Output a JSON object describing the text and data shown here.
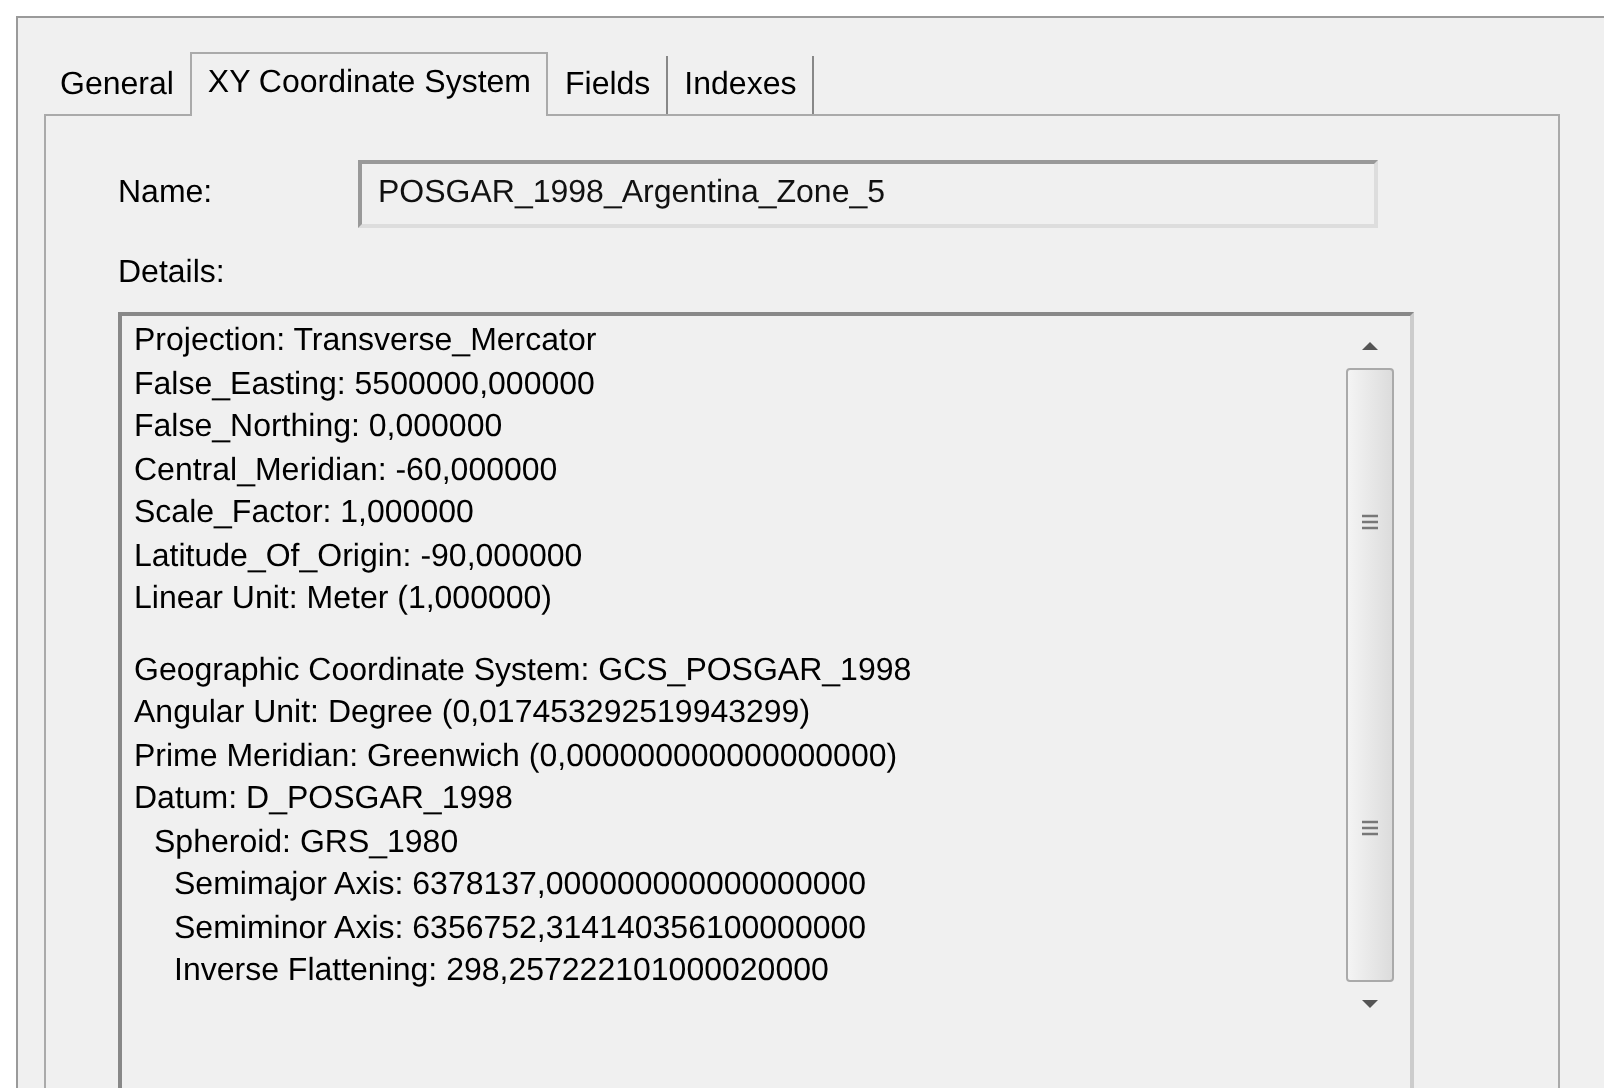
{
  "tabs": [
    {
      "label": "General",
      "selected": false
    },
    {
      "label": "XY Coordinate System",
      "selected": true
    },
    {
      "label": "Fields",
      "selected": false
    },
    {
      "label": "Indexes",
      "selected": false
    }
  ],
  "name_field": {
    "label": "Name:",
    "value": "POSGAR_1998_Argentina_Zone_5"
  },
  "details": {
    "label": "Details:",
    "sections": [
      {
        "lines": [
          {
            "text": "Projection: Transverse_Mercator"
          },
          {
            "text": "False_Easting: 5500000,000000"
          },
          {
            "text": "False_Northing: 0,000000"
          },
          {
            "text": "Central_Meridian: -60,000000"
          },
          {
            "text": "Scale_Factor: 1,000000"
          },
          {
            "text": "Latitude_Of_Origin: -90,000000"
          },
          {
            "text": "Linear Unit: Meter (1,000000)"
          }
        ]
      },
      {
        "lines": [
          {
            "text": "Geographic Coordinate System: GCS_POSGAR_1998"
          },
          {
            "text": "Angular Unit: Degree (0,017453292519943299)"
          },
          {
            "text": "Prime Meridian: Greenwich (0,000000000000000000)"
          },
          {
            "text": "Datum: D_POSGAR_1998",
            "children": [
              {
                "text": "Spheroid: GRS_1980",
                "children": [
                  {
                    "text": "Semimajor Axis: 6378137,000000000000000000"
                  },
                  {
                    "text": "Semiminor Axis: 6356752,314140356100000000"
                  },
                  {
                    "text": "Inverse Flattening: 298,257222101000020000"
                  }
                ]
              }
            ]
          }
        ]
      }
    ]
  }
}
